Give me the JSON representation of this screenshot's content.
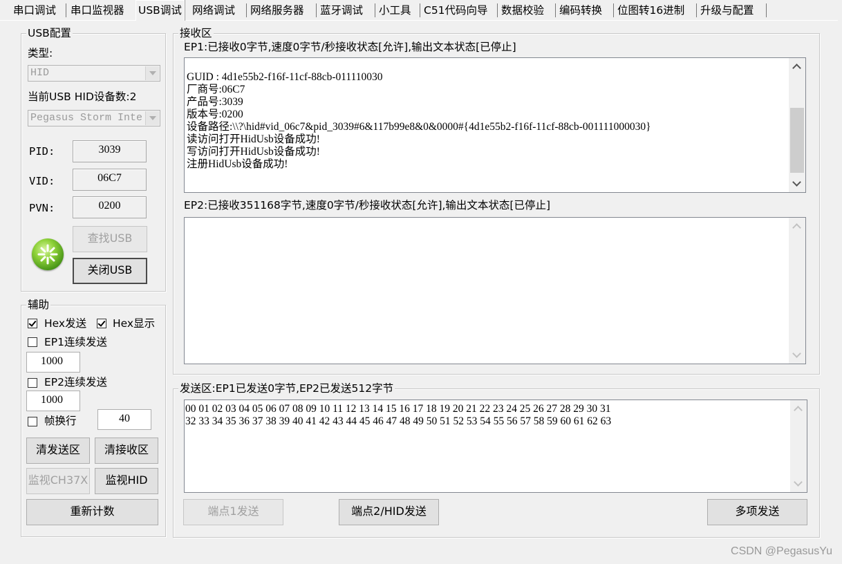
{
  "tabs": [
    {
      "label": "串口调试",
      "selected": false
    },
    {
      "label": "串口监视器",
      "selected": false
    },
    {
      "label": "USB调试",
      "selected": true
    },
    {
      "label": "网络调试",
      "selected": false
    },
    {
      "label": "网络服务器",
      "selected": false
    },
    {
      "label": "蓝牙调试",
      "selected": false
    },
    {
      "label": "小工具",
      "selected": false
    },
    {
      "label": "C51代码向导",
      "selected": false
    },
    {
      "label": "数据校验",
      "selected": false
    },
    {
      "label": "编码转换",
      "selected": false
    },
    {
      "label": "位图转16进制",
      "selected": false
    },
    {
      "label": "升级与配置",
      "selected": false
    }
  ],
  "usb_config": {
    "title": "USB配置",
    "type_label": "类型:",
    "type_value": "HID",
    "device_count_label": "当前USB HID设备数:2",
    "device_value": "Pegasus Storm Inte",
    "pid_label": "PID:",
    "pid_value": "3039",
    "vid_label": "VID:",
    "vid_value": "06C7",
    "pvn_label": "PVN:",
    "pvn_value": "0200",
    "find_button": "查找USB",
    "close_button": "关闭USB"
  },
  "aux": {
    "title": "辅助",
    "hex_send_label": "Hex发送",
    "hex_send_checked": true,
    "hex_show_label": "Hex显示",
    "hex_show_checked": true,
    "ep1_continuous_label": "EP1连续发送",
    "ep1_interval": "1000",
    "ep2_continuous_label": "EP2连续发送",
    "ep2_interval": "1000",
    "frame_newline_label": "帧换行",
    "frame_newline_value": "40",
    "clear_send_button": "清发送区",
    "clear_recv_button": "清接收区",
    "monitor_ch37x_button": "监视CH37X",
    "monitor_hid_button": "监视HID",
    "recount_button": "重新计数"
  },
  "receive": {
    "title": "接收区",
    "ep1_status": "EP1:已接收0字节,速度0字节/秒接收状态[允许],输出文本状态[已停止]",
    "ep1_text": "\nGUID : 4d1e55b2-f16f-11cf-88cb-011110030\n厂商号:06C7\n产品号:3039\n版本号:0200\n设备路径:\\\\?\\hid#vid_06c7&pid_3039#6&117b99e8&0&0000#{4d1e55b2-f16f-11cf-88cb-001111000030}\n读访问打开HidUsb设备成功!\n写访问打开HidUsb设备成功!\n注册HidUsb设备成功!",
    "ep2_status": "EP2:已接收351168字节,速度0字节/秒接收状态[允许],输出文本状态[已停止]",
    "ep2_text": ""
  },
  "send": {
    "title": "发送区:EP1已发送0字节,EP2已发送512字节",
    "text": "00 01 02 03 04 05 06 07 08 09 10 11 12 13 14 15 16 17 18 19 20 21 22 23 24 25 26 27 28 29 30 31\n32 33 34 35 36 37 38 39 40 41 42 43 44 45 46 47 48 49 50 51 52 53 54 55 56 57 58 59 60 61 62 63",
    "ep1_send_button": "端点1发送",
    "ep2_send_button": "端点2/HID发送",
    "multi_send_button": "多项发送"
  },
  "watermark": "CSDN @PegasusYu",
  "colors": {
    "window_bg": "#f0f0f0",
    "disabled_text": "#a0a0a0",
    "logo_green": "#5fb01c"
  }
}
